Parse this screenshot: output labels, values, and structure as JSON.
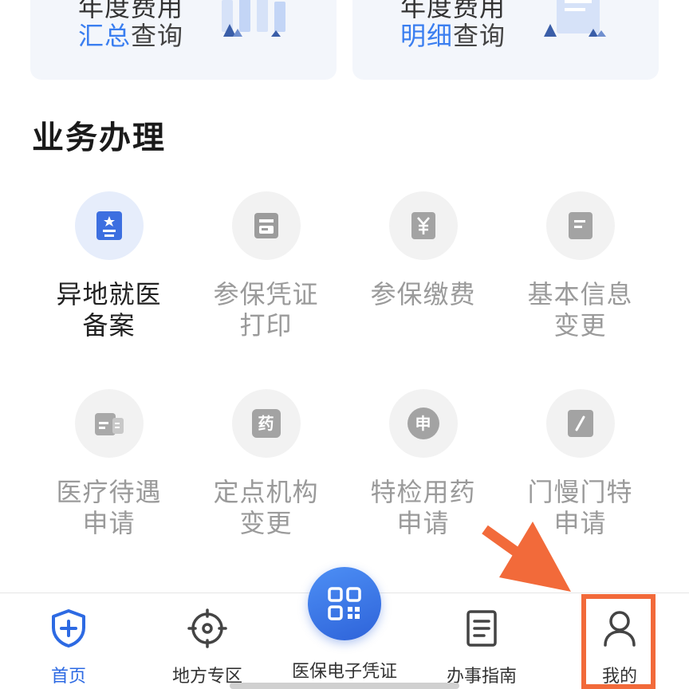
{
  "cards": [
    {
      "line1": "年度费用",
      "line2_highlight": "汇总",
      "line2_rest": "查询"
    },
    {
      "line1": "年度费用",
      "line2_highlight": "明细",
      "line2_rest": "查询"
    }
  ],
  "section": {
    "title": "业务办理"
  },
  "items": [
    {
      "line1": "异地就医",
      "line2": "备案",
      "icon": "id-card-icon"
    },
    {
      "line1": "参保凭证",
      "line2": "打印",
      "icon": "printer-icon"
    },
    {
      "line1": "参保缴费",
      "line2": "",
      "icon": "yuan-icon"
    },
    {
      "line1": "基本信息",
      "line2": "变更",
      "icon": "document-icon"
    },
    {
      "line1": "医疗待遇",
      "line2": "申请",
      "icon": "card-icon"
    },
    {
      "line1": "定点机构",
      "line2": "变更",
      "icon": "medicine-icon",
      "glyph": "药"
    },
    {
      "line1": "特检用药",
      "line2": "申请",
      "icon": "apply-icon",
      "glyph": "申"
    },
    {
      "line1": "门慢门特",
      "line2": "申请",
      "icon": "edit-icon"
    }
  ],
  "nav": {
    "home": "首页",
    "local": "地方专区",
    "voucher": "医保电子凭证",
    "guide": "办事指南",
    "mine": "我的"
  },
  "colors": {
    "accent": "#2d6ae3",
    "annotation": "#f26a3a"
  }
}
